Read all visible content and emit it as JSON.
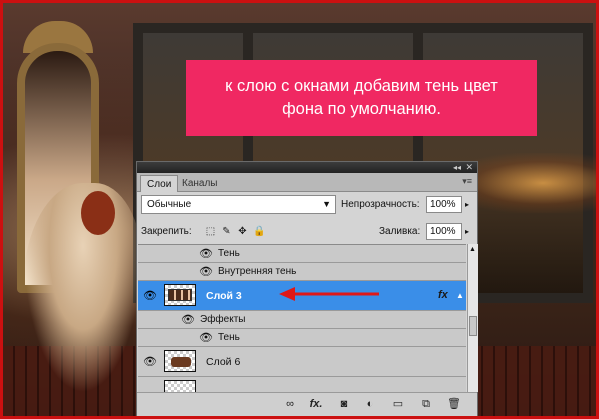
{
  "callout": {
    "line1": "к слою с окнами добавим тень цвет",
    "line2": "фона по умолчанию."
  },
  "panel": {
    "titlebar": {
      "collapse_glyph": "◂◂",
      "close_glyph": "✕"
    },
    "tabs": [
      {
        "label": "Слои",
        "active": true
      },
      {
        "label": "Каналы",
        "active": false
      }
    ],
    "menu_glyph": "▾≡",
    "blend_mode": "Обычные",
    "opacity_label": "Непрозрачность:",
    "opacity_value": "100%",
    "lock_label": "Закрепить:",
    "fill_label": "Заливка:",
    "fill_value": "100%",
    "layers": [
      {
        "type": "effect",
        "label": "Тень"
      },
      {
        "type": "effect",
        "label": "Внутренняя тень"
      },
      {
        "type": "layer",
        "label": "Слой 3",
        "selected": true,
        "fx": "fx"
      },
      {
        "type": "effects-header",
        "label": "Эффекты"
      },
      {
        "type": "effect",
        "label": "Тень"
      },
      {
        "type": "layer",
        "label": "Слой 6",
        "selected": false
      }
    ],
    "footer_icons": [
      "link-icon",
      "fx-icon",
      "mask-icon",
      "adjustment-icon",
      "group-folder-icon",
      "new-layer-icon",
      "trash-icon"
    ],
    "footer_fx_label": "fx."
  },
  "colors": {
    "callout_bg": "#f02862",
    "selected_row": "#3a8ee8",
    "annotation_arrow": "#e01818",
    "border": "#cc1010"
  }
}
